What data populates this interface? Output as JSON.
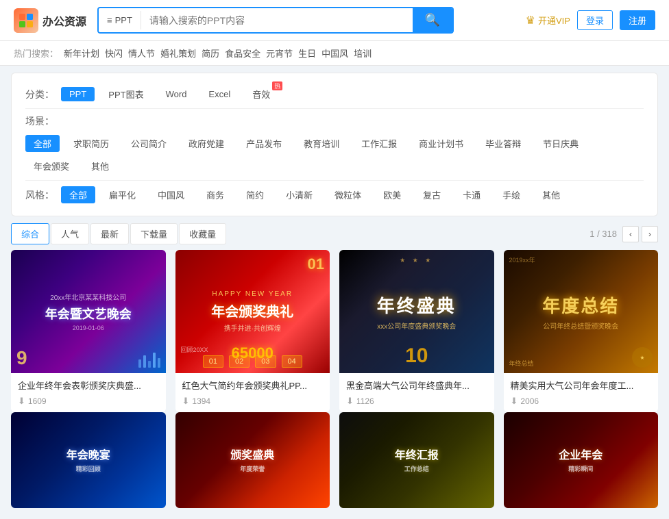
{
  "header": {
    "logo_text": "办公资源",
    "search_type": "PPT",
    "search_placeholder": "请输入搜索的PPT内容",
    "vip_text": "开通VIP",
    "login_text": "登录",
    "register_text": "注册"
  },
  "hot_search": {
    "label": "热门搜索：",
    "tags": [
      "新年计划",
      "快闪",
      "情人节",
      "婚礼策划",
      "简历",
      "食品安全",
      "元宵节",
      "生日",
      "中国风",
      "培训"
    ]
  },
  "filters": {
    "category_label": "分类：",
    "categories": [
      {
        "label": "PPT",
        "active": true
      },
      {
        "label": "PPT图表",
        "active": false
      },
      {
        "label": "Word",
        "active": false
      },
      {
        "label": "Excel",
        "active": false
      },
      {
        "label": "音效",
        "active": false,
        "badge": "热"
      }
    ],
    "scene_label": "场景：",
    "scenes": [
      {
        "label": "全部",
        "active": true
      },
      {
        "label": "求职简历",
        "active": false
      },
      {
        "label": "公司简介",
        "active": false
      },
      {
        "label": "政府党建",
        "active": false
      },
      {
        "label": "产品发布",
        "active": false
      },
      {
        "label": "教育培训",
        "active": false
      },
      {
        "label": "工作汇报",
        "active": false
      },
      {
        "label": "商业计划书",
        "active": false
      },
      {
        "label": "毕业答辩",
        "active": false
      },
      {
        "label": "节日庆典",
        "active": false
      },
      {
        "label": "年会颁奖",
        "active": false
      },
      {
        "label": "其他",
        "active": false
      }
    ],
    "style_label": "风格：",
    "styles": [
      {
        "label": "全部",
        "active": true
      },
      {
        "label": "扁平化",
        "active": false
      },
      {
        "label": "中国风",
        "active": false
      },
      {
        "label": "商务",
        "active": false
      },
      {
        "label": "简约",
        "active": false
      },
      {
        "label": "小清新",
        "active": false
      },
      {
        "label": "微粒体",
        "active": false
      },
      {
        "label": "欧美",
        "active": false
      },
      {
        "label": "复古",
        "active": false
      },
      {
        "label": "卡通",
        "active": false
      },
      {
        "label": "手绘",
        "active": false
      },
      {
        "label": "其他",
        "active": false
      }
    ]
  },
  "sort_bar": {
    "sorts": [
      {
        "label": "综合",
        "active": true
      },
      {
        "label": "人气",
        "active": false
      },
      {
        "label": "最新",
        "active": false
      },
      {
        "label": "下载量",
        "active": false
      },
      {
        "label": "收藏量",
        "active": false
      }
    ],
    "page_info": "1 / 318"
  },
  "cards": [
    {
      "id": 1,
      "title": "企业年终年会表彰颁奖庆典盛...",
      "downloads": "1609",
      "thumb_class": "thumb-1",
      "thumb_lines": [
        "20xx年北京某某科技公司",
        "年会暨文艺晚会",
        "2019-01-06"
      ]
    },
    {
      "id": 2,
      "title": "红色大气简约年会颁奖典礼PP...",
      "downloads": "1394",
      "thumb_class": "thumb-2",
      "thumb_lines": [
        "HAPPY NEW YEAR",
        "年会颁奖典礼",
        "携手并进·共创辉煌"
      ]
    },
    {
      "id": 3,
      "title": "黑金高端大气公司年终盛典年...",
      "downloads": "1126",
      "thumb_class": "thumb-3",
      "thumb_lines": [
        "年终盛典",
        "xxx公司年度盛典颁奖晚会"
      ]
    },
    {
      "id": 4,
      "title": "精美实用大气公司年会年度工...",
      "downloads": "2006",
      "thumb_class": "thumb-4",
      "thumb_lines": [
        "年度总结",
        "公司年终总结暨颁奖晚会"
      ]
    }
  ],
  "bottom_cards": [
    {
      "id": 5,
      "thumb_class": "thumb-5"
    },
    {
      "id": 6,
      "thumb_class": "thumb-6"
    },
    {
      "id": 7,
      "thumb_class": "thumb-7"
    },
    {
      "id": 8,
      "thumb_class": "thumb-8"
    }
  ],
  "colors": {
    "primary": "#1890ff",
    "active_tag": "#1890ff",
    "hot_badge": "#ff4d4f"
  }
}
